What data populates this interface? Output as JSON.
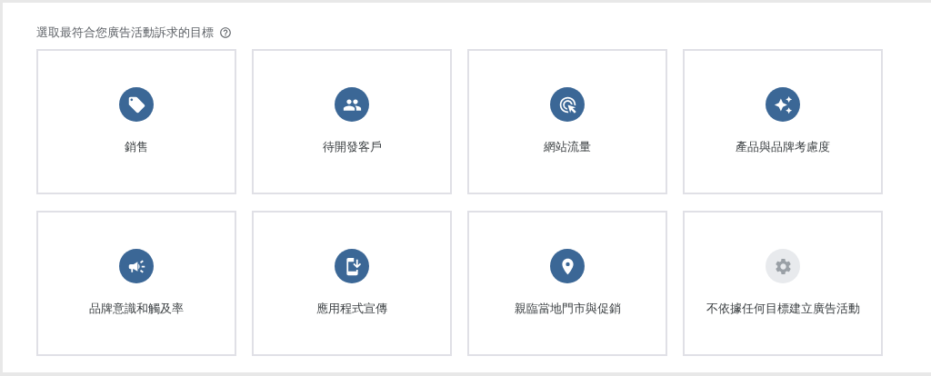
{
  "heading": "選取最符合您廣告活動訴求的目標",
  "goals": [
    {
      "label": "銷售",
      "kind": "tag"
    },
    {
      "label": "待開發客戶",
      "kind": "people"
    },
    {
      "label": "網站流量",
      "kind": "cursor"
    },
    {
      "label": "產品與品牌考慮度",
      "kind": "sparkle"
    },
    {
      "label": "品牌意識和觸及率",
      "kind": "megaphone"
    },
    {
      "label": "應用程式宣傳",
      "kind": "phone"
    },
    {
      "label": "親臨當地門市與促銷",
      "kind": "pin"
    },
    {
      "label": "不依據任何目標建立廣告活動",
      "kind": "gear"
    }
  ]
}
